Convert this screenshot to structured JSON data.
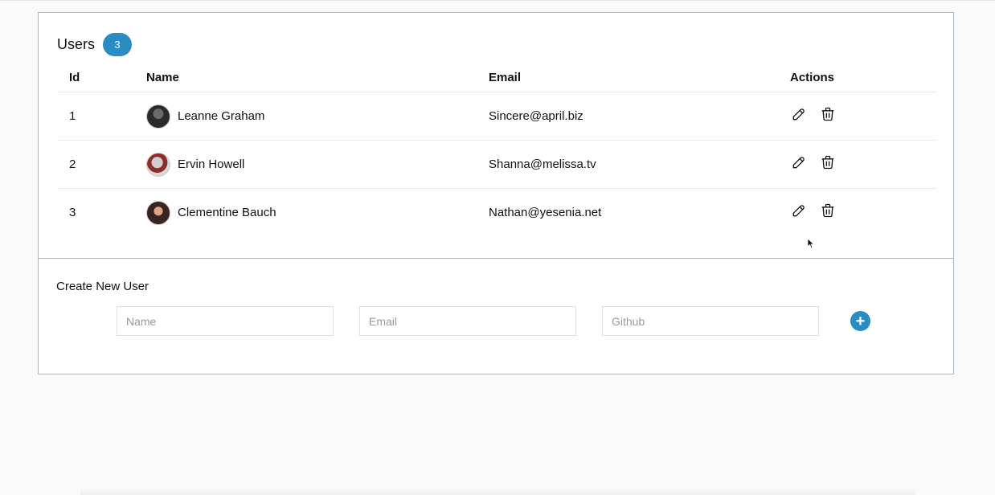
{
  "users_panel": {
    "title": "Users",
    "count": "3",
    "columns": [
      "Id",
      "Name",
      "Email",
      "Actions"
    ],
    "rows": [
      {
        "id": "1",
        "name": "Leanne Graham",
        "email": "Sincere@april.biz",
        "avatar_icon": "user-avatar"
      },
      {
        "id": "2",
        "name": "Ervin Howell",
        "email": "Shanna@melissa.tv",
        "avatar_icon": "user-avatar"
      },
      {
        "id": "3",
        "name": "Clementine Bauch",
        "email": "Nathan@yesenia.net",
        "avatar_icon": "user-avatar"
      }
    ],
    "action_icons": [
      "edit-icon",
      "trash-icon"
    ]
  },
  "create_panel": {
    "title": "Create New User",
    "name_placeholder": "Name",
    "email_placeholder": "Email",
    "github_placeholder": "Github",
    "add_icon": "plus-icon"
  },
  "colors": {
    "accent": "#2a8cc2",
    "panel_border": "#9dbbd9",
    "background": "#fafafa"
  }
}
